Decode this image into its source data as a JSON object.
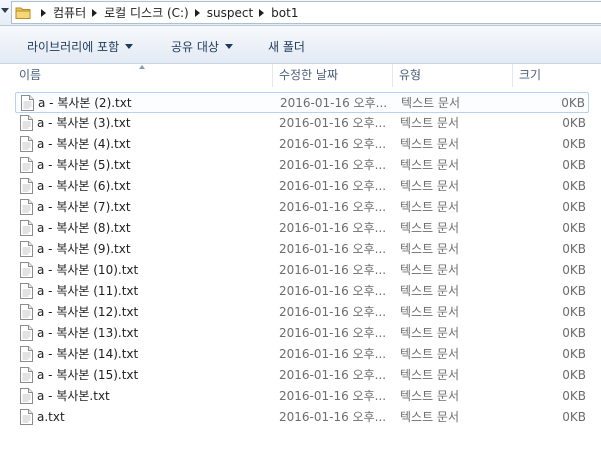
{
  "address": {
    "crumbs": [
      "컴퓨터",
      "로컬 디스크 (C:)",
      "suspect",
      "bot1"
    ]
  },
  "toolbar": {
    "include_library": "라이브러리에 포함",
    "share_with": "공유 대상",
    "new_folder": "새 폴더"
  },
  "columns": {
    "name": "이름",
    "date": "수정한 날짜",
    "type": "유형",
    "size": "크기"
  },
  "files": [
    {
      "name": "a - 복사본 (2).txt",
      "date": "2016-01-16 오후...",
      "type": "텍스트 문서",
      "size": "0KB"
    },
    {
      "name": "a - 복사본 (3).txt",
      "date": "2016-01-16 오후...",
      "type": "텍스트 문서",
      "size": "0KB"
    },
    {
      "name": "a - 복사본 (4).txt",
      "date": "2016-01-16 오후...",
      "type": "텍스트 문서",
      "size": "0KB"
    },
    {
      "name": "a - 복사본 (5).txt",
      "date": "2016-01-16 오후...",
      "type": "텍스트 문서",
      "size": "0KB"
    },
    {
      "name": "a - 복사본 (6).txt",
      "date": "2016-01-16 오후...",
      "type": "텍스트 문서",
      "size": "0KB"
    },
    {
      "name": "a - 복사본 (7).txt",
      "date": "2016-01-16 오후...",
      "type": "텍스트 문서",
      "size": "0KB"
    },
    {
      "name": "a - 복사본 (8).txt",
      "date": "2016-01-16 오후...",
      "type": "텍스트 문서",
      "size": "0KB"
    },
    {
      "name": "a - 복사본 (9).txt",
      "date": "2016-01-16 오후...",
      "type": "텍스트 문서",
      "size": "0KB"
    },
    {
      "name": "a - 복사본 (10).txt",
      "date": "2016-01-16 오후...",
      "type": "텍스트 문서",
      "size": "0KB"
    },
    {
      "name": "a - 복사본 (11).txt",
      "date": "2016-01-16 오후...",
      "type": "텍스트 문서",
      "size": "0KB"
    },
    {
      "name": "a - 복사본 (12).txt",
      "date": "2016-01-16 오후...",
      "type": "텍스트 문서",
      "size": "0KB"
    },
    {
      "name": "a - 복사본 (13).txt",
      "date": "2016-01-16 오후...",
      "type": "텍스트 문서",
      "size": "0KB"
    },
    {
      "name": "a - 복사본 (14).txt",
      "date": "2016-01-16 오후...",
      "type": "텍스트 문서",
      "size": "0KB"
    },
    {
      "name": "a - 복사본 (15).txt",
      "date": "2016-01-16 오후...",
      "type": "텍스트 문서",
      "size": "0KB"
    },
    {
      "name": "a - 복사본.txt",
      "date": "2016-01-16 오후...",
      "type": "텍스트 문서",
      "size": "0KB"
    },
    {
      "name": "a.txt",
      "date": "2016-01-16 오후...",
      "type": "텍스트 문서",
      "size": "0KB"
    }
  ],
  "icons": {
    "location": "folder-icon",
    "file": "text-file-icon"
  },
  "colors": {
    "focus_border": "#b8d1ef",
    "toolbar_text": "#1e3a5c",
    "secondary_text": "#6d6d6d"
  }
}
